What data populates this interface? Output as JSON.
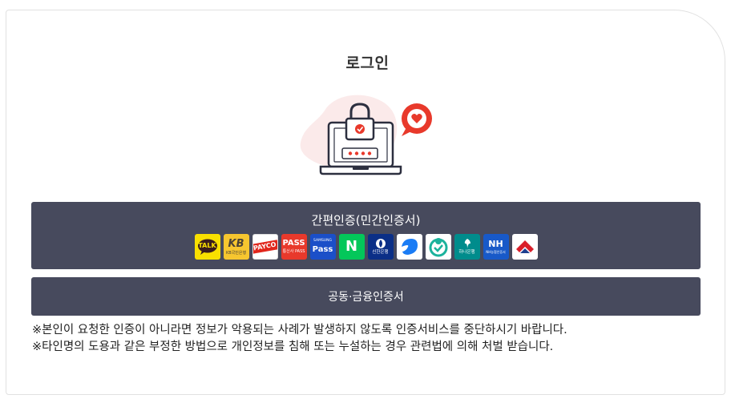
{
  "login": {
    "title": "로그인",
    "simple_auth": {
      "label": "간편인증(민간인증서)",
      "providers": [
        {
          "name": "kakao-talk",
          "text": "TALK",
          "bg": "#f9e000",
          "fg": "#3a1d1d"
        },
        {
          "name": "kb",
          "text": "KB",
          "sub": "KB국민은행",
          "bg": "#f7c62f",
          "fg": "#4b4236"
        },
        {
          "name": "payco",
          "text": "PAYCO",
          "bg": "#ffffff",
          "fg": "#e1261c"
        },
        {
          "name": "pass",
          "text": "PASS",
          "sub": "통신사 PASS",
          "bg": "#e8392b",
          "fg": "#ffffff"
        },
        {
          "name": "samsung-pass",
          "text": "Pass",
          "sub": "SAMSUNG",
          "bg": "#1b4fc8",
          "fg": "#ffffff"
        },
        {
          "name": "naver",
          "text": "N",
          "bg": "#03c75a",
          "fg": "#ffffff"
        },
        {
          "name": "shinhan",
          "text": "신한은행",
          "bg": "#0b2f87",
          "fg": "#ffffff"
        },
        {
          "name": "toss",
          "bg": "#ffffff",
          "fg": "#1a7cf5"
        },
        {
          "name": "green-cert",
          "bg": "#ffffff",
          "fg": "#1bb29c"
        },
        {
          "name": "hana",
          "text": "하나은행",
          "bg": "#008c8c",
          "fg": "#ffffff"
        },
        {
          "name": "nh",
          "text": "NH",
          "sub": "NH농협인증서",
          "bg": "#1859c8",
          "fg": "#ffffff"
        },
        {
          "name": "woori",
          "bg": "#ffffff",
          "fg": "#d91e2a"
        }
      ]
    },
    "cert_auth": {
      "label": "공동·금융인증서"
    },
    "notices": [
      "※본인이 요청한 인증이 아니라면 정보가 악용되는 사례가 발생하지 않도록 인증서비스를 중단하시기 바랍니다.",
      "※타인명의 도용과 같은 부정한 방법으로 개인정보를 침해 또는 누설하는 경우 관련법에 의해 처벌 받습니다."
    ],
    "colors": {
      "button_bg": "#474a5d",
      "accent": "#e8392b",
      "blob": "#fbeaea"
    }
  }
}
